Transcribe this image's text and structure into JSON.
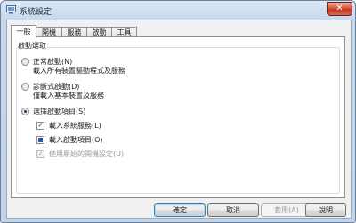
{
  "window": {
    "title": "系統設定",
    "close_glyph": "✕"
  },
  "tabs": [
    {
      "label": "一般",
      "active": true
    },
    {
      "label": "開機",
      "active": false
    },
    {
      "label": "服務",
      "active": false
    },
    {
      "label": "啟動",
      "active": false
    },
    {
      "label": "工具",
      "active": false
    }
  ],
  "startup": {
    "group_label": "啟動選取",
    "options": [
      {
        "title": "正常啟動(N)",
        "description": "載入所有裝置驅動程式及服務",
        "selected": false
      },
      {
        "title": "診斷式啟動(D)",
        "description": "僅載入基本裝置及服務",
        "selected": false
      },
      {
        "title": "選擇啟動項目(S)",
        "selected": true
      }
    ],
    "selective_items": [
      {
        "label": "載入系統服務(L)",
        "state": "checked",
        "enabled": true
      },
      {
        "label": "載入啟動項目(O)",
        "state": "mixed",
        "enabled": true
      },
      {
        "label": "使用原始的開機設定(U)",
        "state": "checked",
        "enabled": false
      }
    ]
  },
  "buttons": {
    "ok": "確定",
    "cancel": "取消",
    "apply": "套用(A)",
    "help": "說明"
  },
  "icons": {
    "app": "system-config-icon",
    "check_glyph": "✓"
  }
}
